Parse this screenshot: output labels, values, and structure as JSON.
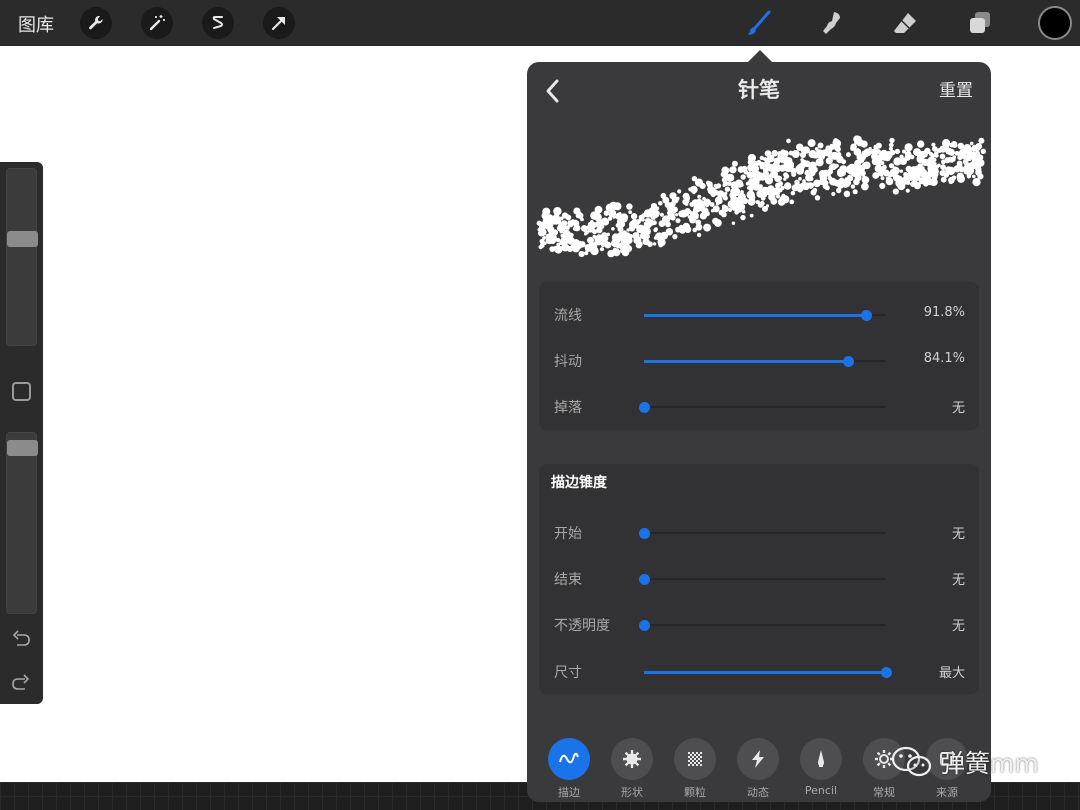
{
  "topbar": {
    "gallery_label": "图库",
    "left_tools": [
      "wrench-icon",
      "magic-wand-icon",
      "selection-icon",
      "transform-arrow-icon"
    ],
    "right_tools": [
      "brush-icon",
      "smudge-icon",
      "eraser-icon",
      "layers-icon"
    ],
    "active_tool": "brush-icon",
    "accent_color": "#1a73e8",
    "current_color": "#000000"
  },
  "sidebar": {
    "size_slider_level": 0.62,
    "opacity_slider_level": 0.96
  },
  "panel": {
    "title": "针笔",
    "reset_label": "重置",
    "stroke_group": {
      "rows": [
        {
          "label": "流线",
          "value": "91.8%",
          "level": 0.918
        },
        {
          "label": "抖动",
          "value": "84.1%",
          "level": 0.841
        },
        {
          "label": "掉落",
          "value": "无",
          "level": 0.0
        }
      ]
    },
    "taper_group": {
      "title": "描边锥度",
      "rows": [
        {
          "label": "开始",
          "value": "无",
          "level": 0.0
        },
        {
          "label": "结束",
          "value": "无",
          "level": 0.0
        },
        {
          "label": "不透明度",
          "value": "无",
          "level": 0.0
        },
        {
          "label": "尺寸",
          "value": "最大",
          "level": 1.0
        }
      ]
    },
    "tabs": [
      {
        "label": "描边",
        "icon": "stroke-wave-icon",
        "active": true
      },
      {
        "label": "形状",
        "icon": "shape-gear-icon",
        "active": false
      },
      {
        "label": "颗粒",
        "icon": "grain-checker-icon",
        "active": false
      },
      {
        "label": "动态",
        "icon": "lightning-icon",
        "active": false
      },
      {
        "label": "Pencil",
        "icon": "pencil-tip-icon",
        "active": false
      },
      {
        "label": "常规",
        "icon": "settings-icon",
        "active": false
      },
      {
        "label": "来源",
        "icon": "source-icon",
        "active": false
      }
    ]
  },
  "watermark": {
    "text": "弹簧mm",
    "icon": "wechat-icon"
  }
}
